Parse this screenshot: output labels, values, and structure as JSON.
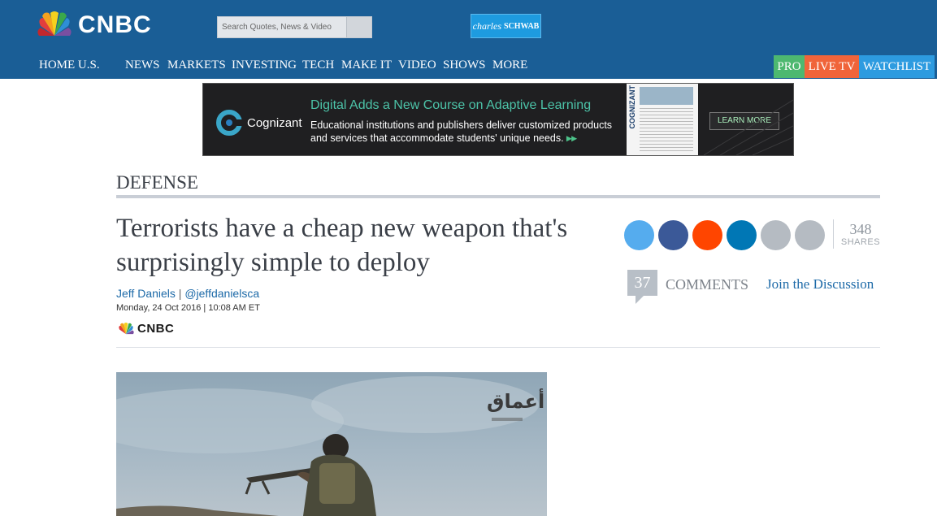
{
  "header": {
    "logo_text": "CNBC",
    "search": {
      "placeholder": "Search Quotes, News & Video"
    },
    "sponsor": {
      "italic": "charles",
      "text": "SCHWAB"
    }
  },
  "nav": {
    "items": [
      "HOME U.S.",
      "NEWS",
      "MARKETS",
      "INVESTING",
      "TECH",
      "MAKE IT",
      "VIDEO",
      "SHOWS",
      "MORE"
    ],
    "pro": "PRO",
    "live_tv": "LIVE TV",
    "watchlist": "WATCHLIST"
  },
  "ad": {
    "brand": "Cognizant",
    "headline": "Digital Adds a New Course on Adaptive Learning",
    "body": "Educational institutions and publishers deliver customized products and services that accommodate students' unique needs.",
    "cta": "LEARN MORE",
    "paper_brand": "COGNIZANT"
  },
  "article": {
    "section": "DEFENSE",
    "title": "Terrorists have a cheap new weapon that's surprisingly simple to deploy",
    "author": "Jeff Daniels",
    "separator": "|",
    "handle": "@jeffdanielsca",
    "date": "Monday, 24 Oct 2016 | 10:08 AM ET",
    "source": "CNBC",
    "photo_watermark": "أعماق"
  },
  "social": {
    "share_count": "348",
    "shares_label": "SHARES",
    "buttons": [
      {
        "name": "twitter-share-button",
        "color": "#55acee"
      },
      {
        "name": "facebook-share-button",
        "color": "#3b5998"
      },
      {
        "name": "reddit-share-button",
        "color": "#ff4500"
      },
      {
        "name": "linkedin-share-button",
        "color": "#0077b5"
      },
      {
        "name": "email-share-button",
        "color": "#b5bbc2"
      },
      {
        "name": "more-share-button",
        "color": "#b5bbc2"
      }
    ]
  },
  "comments": {
    "count": "37",
    "label": "COMMENTS",
    "join": "Join the Discussion"
  },
  "colors": {
    "header_bg": "#1a5e96",
    "pro": "#4db870",
    "live_tv": "#f0643a",
    "watchlist": "#2d9be0",
    "link": "#1d6aa8"
  }
}
